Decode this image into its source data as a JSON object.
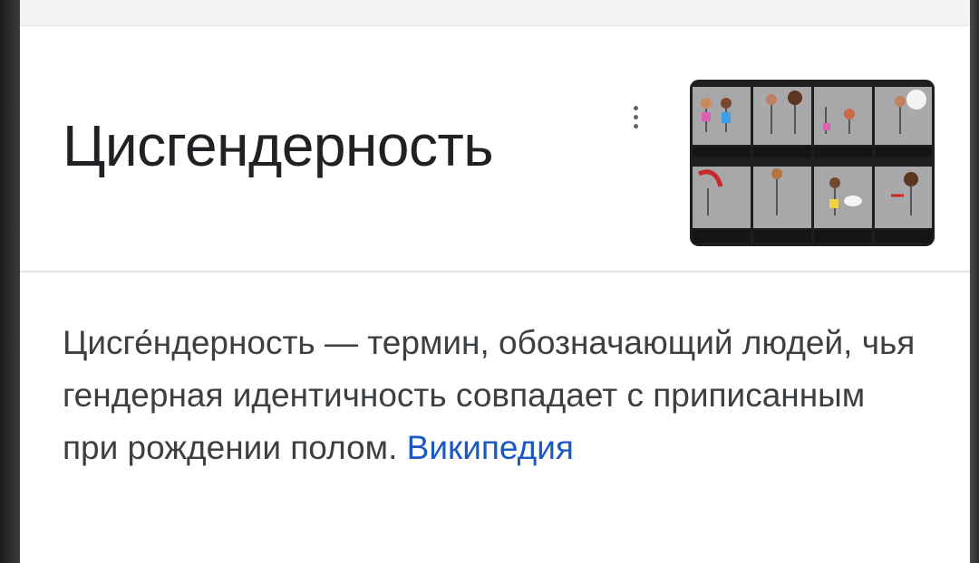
{
  "knowledge_panel": {
    "title": "Цисгендерность",
    "more_options_icon": "vertical-dots-icon",
    "thumbnail_description": "comic-strip-thumbnail",
    "description": "Цисге́ндерность — термин, обозначающий людей, чья гендерная идентичность совпадает с приписанным при рождении полом.",
    "source_link": "Википедия",
    "colors": {
      "link": "#1a58c6",
      "title": "#202124",
      "text": "#3c4043"
    }
  }
}
